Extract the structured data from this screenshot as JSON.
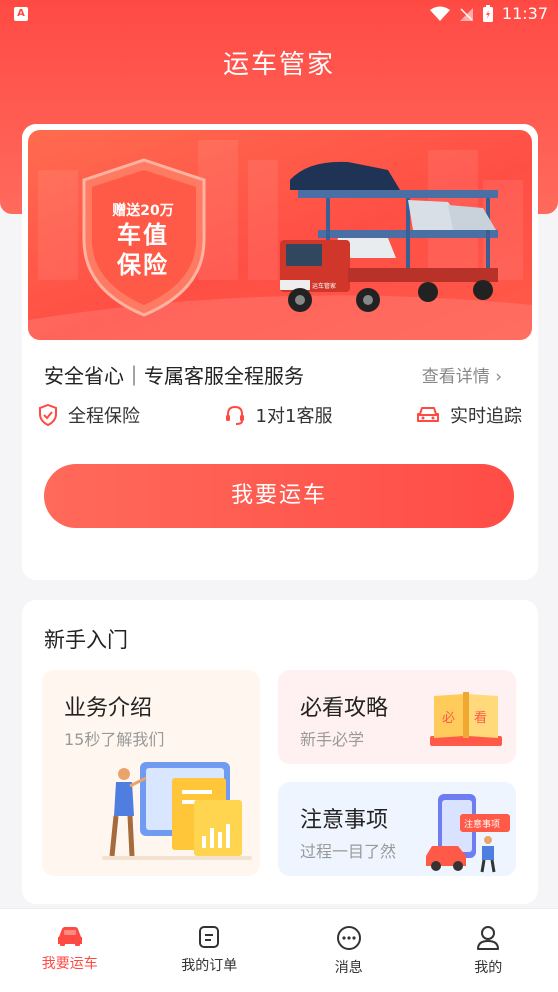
{
  "status_bar": {
    "time": "11:37",
    "app_badge": "A"
  },
  "header": {
    "title": "运车管家"
  },
  "banner": {
    "shield_line1": "赠送20万",
    "shield_line2": "车值",
    "shield_line3": "保险",
    "truck_plate": "运车管家"
  },
  "service": {
    "slogan": "安全省心｜专属客服全程服务",
    "details_link": "查看详情 ›",
    "features": [
      {
        "icon": "shield-check-icon",
        "label": "全程保险"
      },
      {
        "icon": "headset-icon",
        "label": "1对1客服"
      },
      {
        "icon": "car-tracking-icon",
        "label": "实时追踪"
      }
    ],
    "cta": "我要运车"
  },
  "guide": {
    "title": "新手入门",
    "tiles": [
      {
        "title": "业务介绍",
        "subtitle": "15秒了解我们"
      },
      {
        "title": "必看攻略",
        "subtitle": "新手必学",
        "book_left": "必",
        "book_right": "看"
      },
      {
        "title": "注意事项",
        "subtitle": "过程一目了然",
        "phone_tag": "注意事项"
      }
    ]
  },
  "tabbar": {
    "items": [
      {
        "label": "我要运车",
        "icon": "car-icon",
        "active": true
      },
      {
        "label": "我的订单",
        "icon": "order-icon",
        "active": false
      },
      {
        "label": "消息",
        "icon": "message-icon",
        "active": false
      },
      {
        "label": "我的",
        "icon": "user-icon",
        "active": false
      }
    ]
  },
  "colors": {
    "accent": "#ff4a44",
    "header_bg": "#ff5a4e",
    "page_bg": "#f5f5f7"
  }
}
